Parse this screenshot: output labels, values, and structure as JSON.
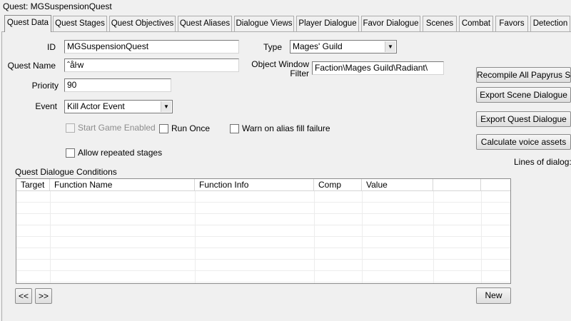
{
  "window": {
    "title": "Quest: MGSuspensionQuest"
  },
  "tabs": [
    {
      "label": "Quest Data",
      "active": true
    },
    {
      "label": "Quest Stages"
    },
    {
      "label": "Quest Objectives"
    },
    {
      "label": "Quest Aliases"
    },
    {
      "label": "Dialogue Views"
    },
    {
      "label": "Player Dialogue"
    },
    {
      "label": "Favor Dialogue"
    },
    {
      "label": "Scenes"
    },
    {
      "label": "Combat"
    },
    {
      "label": "Favors"
    },
    {
      "label": "Detection"
    }
  ],
  "form": {
    "id_label": "ID",
    "id_value": "MGSuspensionQuest",
    "name_label": "Quest Name",
    "name_value": "ˆåŀw",
    "priority_label": "Priority",
    "priority_value": "90",
    "event_label": "Event",
    "event_value": "Kill Actor Event",
    "type_label": "Type",
    "type_value": "Mages' Guild",
    "filter_label_line1": "Object Window",
    "filter_label_line2": "Filter",
    "filter_value": "Faction\\Mages Guild\\Radiant\\",
    "start_game_enabled_label": "Start Game Enabled",
    "run_once_label": "Run Once",
    "warn_alias_label": "Warn on alias fill failure",
    "allow_repeated_label": "Allow repeated stages"
  },
  "actions": {
    "recompile_label": "Recompile All Papyrus Sc",
    "export_scene_label": "Export Scene Dialogue",
    "export_quest_label": "Export Quest Dialogue",
    "calc_voice_label": "Calculate voice assets",
    "lines_of_dialog_label": "Lines of dialog:"
  },
  "conditions": {
    "section_label": "Quest Dialogue Conditions",
    "columns": [
      "Target",
      "Function Name",
      "Function Info",
      "Comp",
      "Value",
      "",
      ""
    ],
    "prev_label": "<<",
    "next_label": ">>",
    "new_label": "New"
  },
  "icons": {
    "dropdown": "chevron-down-icon"
  }
}
